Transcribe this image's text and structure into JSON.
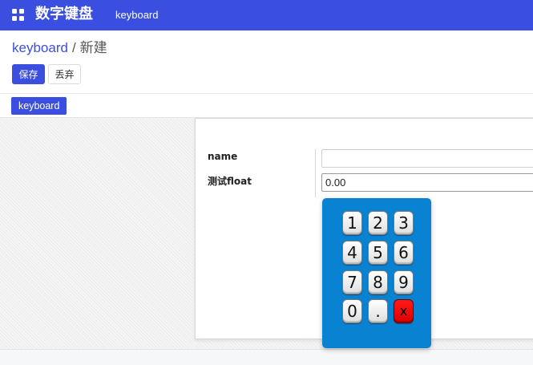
{
  "topbar": {
    "app_title": "数字键盘",
    "menu_item": "keyboard"
  },
  "breadcrumb": {
    "parent": "keyboard",
    "separator": "/",
    "current": "新建"
  },
  "actions": {
    "save_label": "保存",
    "discard_label": "丢弃"
  },
  "status": {
    "tag_label": "keyboard"
  },
  "form": {
    "name_label": "name",
    "name_value": "",
    "float_label": "测试float",
    "float_value": "0.00"
  },
  "keypad": {
    "keys": [
      "1",
      "2",
      "3",
      "4",
      "5",
      "6",
      "7",
      "8",
      "9",
      "0",
      ".",
      "x"
    ],
    "delete_color": "#ff0000",
    "panel_color": "#0a82d2"
  },
  "colors": {
    "brand": "#3a4fe0"
  },
  "icons": {
    "apps": "grid-apps-icon"
  }
}
